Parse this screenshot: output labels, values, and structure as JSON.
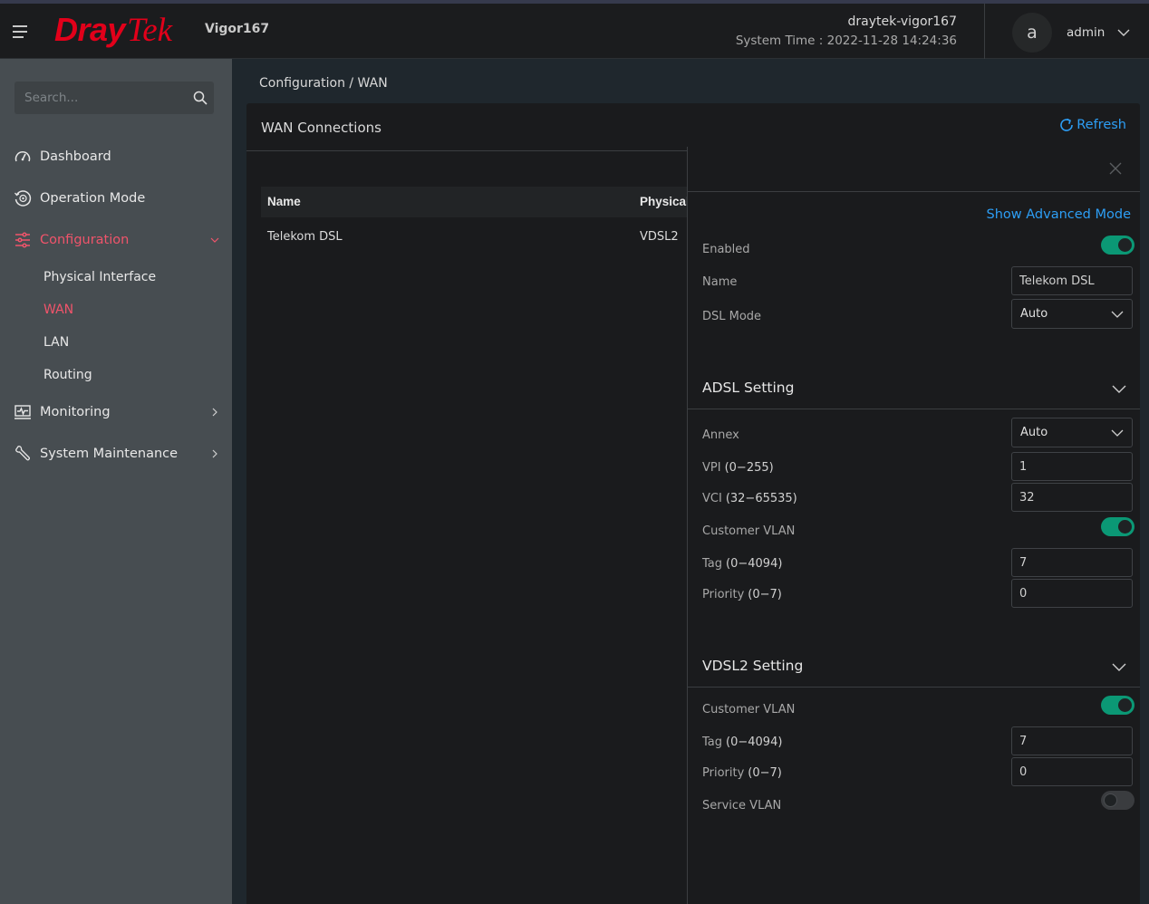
{
  "header": {
    "logo_part1": "Dray",
    "logo_part2": "Tek",
    "model": "Vigor167",
    "hostname": "draytek-vigor167",
    "system_time_label": "System Time : 2022-11-28 14:24:36",
    "avatar_letter": "a",
    "username": "admin"
  },
  "sidebar": {
    "search_placeholder": "Search...",
    "items": [
      {
        "label": "Dashboard",
        "icon": "dashboard-gauge-icon"
      },
      {
        "label": "Operation Mode",
        "icon": "operation-mode-icon"
      },
      {
        "label": "Configuration",
        "icon": "sliders-icon",
        "active": true,
        "expanded": true
      },
      {
        "label": "Monitoring",
        "icon": "monitor-pulse-icon"
      },
      {
        "label": "System Maintenance",
        "icon": "wrench-icon"
      }
    ],
    "sub_items": [
      {
        "label": "Physical Interface"
      },
      {
        "label": "WAN",
        "active": true
      },
      {
        "label": "LAN"
      },
      {
        "label": "Routing"
      }
    ]
  },
  "breadcrumb": "Configuration / WAN",
  "panel": {
    "title": "WAN Connections",
    "refresh_label": "Refresh",
    "table": {
      "columns": [
        "Name",
        "Physical"
      ],
      "rows": [
        [
          "Telekom DSL",
          "VDSL2"
        ]
      ]
    }
  },
  "drawer": {
    "show_advanced_label": "Show Advanced Mode",
    "enabled": {
      "label": "Enabled",
      "value": true
    },
    "name": {
      "label": "Name",
      "value": "Telekom DSL"
    },
    "dsl_mode": {
      "label": "DSL Mode",
      "value": "Auto"
    },
    "adsl": {
      "title": "ADSL Setting",
      "annex": {
        "label": "Annex",
        "value": "Auto"
      },
      "vpi": {
        "label": "VPI",
        "range": "(0−255)",
        "value": "1"
      },
      "vci": {
        "label": "VCI",
        "range": "(32−65535)",
        "value": "32"
      },
      "customer_vlan": {
        "label": "Customer VLAN",
        "value": true
      },
      "tag": {
        "label": "Tag",
        "range": "(0−4094)",
        "value": "7"
      },
      "priority": {
        "label": "Priority",
        "range": "(0−7)",
        "value": "0"
      }
    },
    "vdsl2": {
      "title": "VDSL2 Setting",
      "customer_vlan": {
        "label": "Customer VLAN",
        "value": true
      },
      "tag": {
        "label": "Tag",
        "range": "(0−4094)",
        "value": "7"
      },
      "priority": {
        "label": "Priority",
        "range": "(0−7)",
        "value": "0"
      },
      "service_vlan": {
        "label": "Service VLAN",
        "value": false
      }
    }
  },
  "colors": {
    "brand_red": "#e2001a",
    "active_nav": "#f0546b",
    "link_blue": "#2d9ef5",
    "toggle_on": "#0b9875"
  }
}
